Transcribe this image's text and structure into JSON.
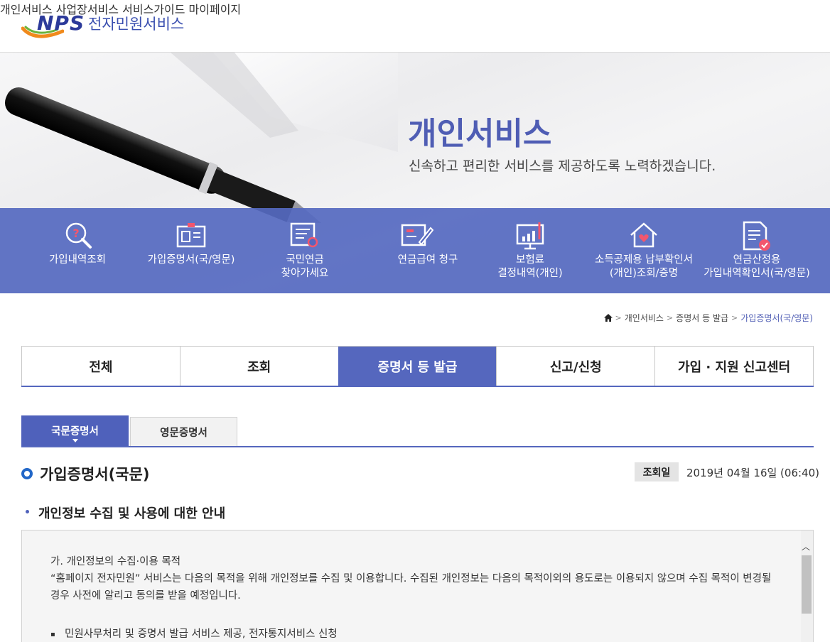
{
  "header": {
    "logo_brand": "NPS",
    "logo_service": "전자민원서비스",
    "nav": [
      "개인서비스",
      "사업장서비스",
      "서비스가이드",
      "마이페이지"
    ]
  },
  "banner": {
    "title": "개인서비스",
    "description": "신속하고 편리한 서비스를 제공하도록 노력하겠습니다."
  },
  "quick_menu": [
    {
      "label": "가입내역조회",
      "icon": "search-question-icon"
    },
    {
      "label": "가입증명서(국/영문)",
      "icon": "id-card-icon"
    },
    {
      "label": "국민연금\n찾아가세요",
      "icon": "document-search-icon"
    },
    {
      "label": "연금급여 청구",
      "icon": "document-pen-icon"
    },
    {
      "label": "보험료\n결정내역(개인)",
      "icon": "monitor-chart-icon"
    },
    {
      "label": "소득공제용 납부확인서\n(개인)조회/증명",
      "icon": "house-heart-icon"
    },
    {
      "label": "연금산정용\n가입내역확인서(국/영문)",
      "icon": "document-check-icon"
    }
  ],
  "breadcrumb": [
    "개인서비스",
    "증명서 등 발급",
    "가입증명서(국/영문)"
  ],
  "tabs": [
    "전체",
    "조회",
    "증명서 등 발급",
    "신고/신청",
    "가입 · 지원 신고센터"
  ],
  "subtabs": [
    "국문증명서",
    "영문증명서"
  ],
  "page": {
    "title": "가입증명서(국문)",
    "date_label": "조회일",
    "date_value": "2019년 04월 16일 (06:40)",
    "section_title": "개인정보 수집 및 사용에 대한 안내"
  },
  "content": {
    "heading": "가. 개인정보의 수집·이용 목적",
    "paragraph": "“홈페이지 전자민원” 서비스는 다음의 목적을 위해 개인정보를 수집 및 이용합니다. 수집된 개인정보는 다음의 목적이외의 용도로는 이용되지 않으며 수집 목적이 변경될 경우 사전에 알리고 동의를 받을 예정입니다.",
    "list_item": "민원사무처리 및 증명서 발급 서비스 제공, 전자통지서비스 신청"
  },
  "colors": {
    "brand": "#4f61bb",
    "tab_active": "#5567be",
    "breadcrumb_current": "#4f5db4"
  }
}
